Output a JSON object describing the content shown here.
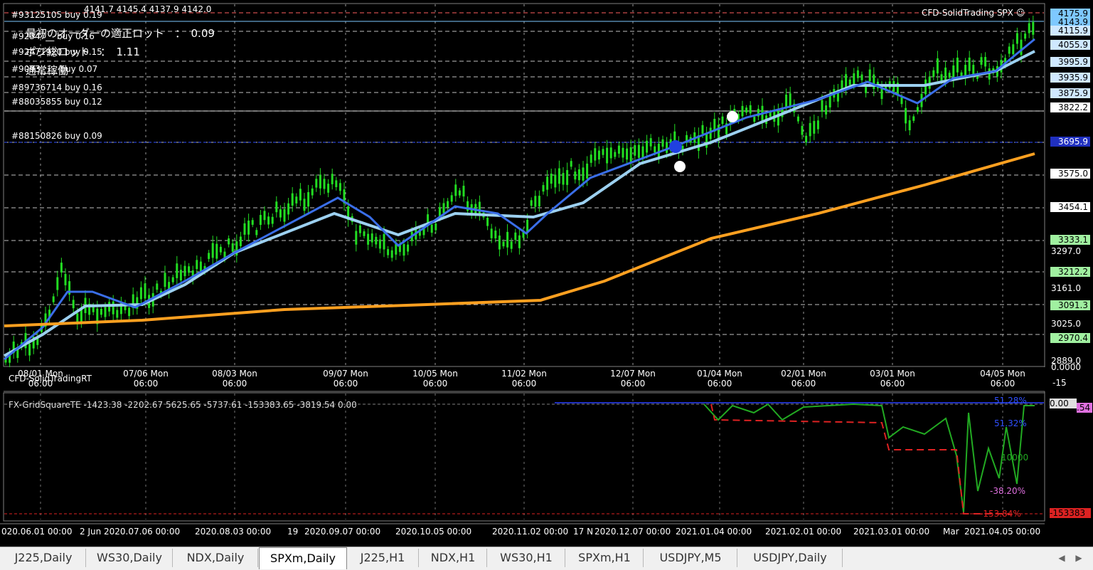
{
  "symbol_title": "CFD-SolidTrading SPX",
  "ohlc": "4141.7 4145.4 4137.9 4142.0",
  "info": {
    "first_order_lot": "最初のオーダーの適正ロット　：　0.09",
    "total_lot": "ポジ総ロット　：　1.11",
    "status": "通常稼働"
  },
  "orders": [
    "#93125105 buy 0.19",
    "#92347__ buy 0.16",
    "#92471920 buy 0.15",
    "#9093____ buy 0.07",
    "#89736714 buy 0.16",
    "#88035855 buy 0.12",
    "#88150826 buy 0.09"
  ],
  "price_axis": {
    "boxes": [
      {
        "value": "4175.9",
        "color": "#7ec8ff"
      },
      {
        "value": "4143.9",
        "color": "#7ec8ff"
      },
      {
        "value": "4115.9",
        "color": "#cfe8ff"
      },
      {
        "value": "4055.9",
        "color": "#cfe8ff"
      },
      {
        "value": "3995.9",
        "color": "#cfe8ff"
      },
      {
        "value": "3935.9",
        "color": "#cfe8ff"
      },
      {
        "value": "3875.9",
        "color": "#cfe8ff"
      },
      {
        "value": "3822.2",
        "color": "#ffffff"
      },
      {
        "value": "3695.9",
        "color": "#2030c0"
      },
      {
        "value": "3575.0",
        "color": "#ffffff"
      },
      {
        "value": "3454.1",
        "color": "#ffffff"
      },
      {
        "value": "3333.1",
        "color": "#a0f0a0"
      },
      {
        "value": "3212.2",
        "color": "#a0f0a0"
      },
      {
        "value": "3091.3",
        "color": "#a0f0a0"
      },
      {
        "value": "2970.4",
        "color": "#a0f0a0"
      }
    ],
    "ticks": [
      "3297.0",
      "3161.0",
      "3025.0",
      "2889.0"
    ]
  },
  "time_axis": [
    {
      "date": "08/01 Mon",
      "time": "06:00"
    },
    {
      "date": "07/06 Mon",
      "time": "06:00"
    },
    {
      "date": "08/03 Mon",
      "time": "06:00"
    },
    {
      "date": "09/07 Mon",
      "time": "06:00"
    },
    {
      "date": "10/05 Mon",
      "time": "06:00"
    },
    {
      "date": "11/02 Mon",
      "time": "06:00"
    },
    {
      "date": "12/07 Mon",
      "time": "06:00"
    },
    {
      "date": "01/04 Mon",
      "time": "06:00"
    },
    {
      "date": "02/01 Mon",
      "time": "06:00"
    },
    {
      "date": "03/01 Mon",
      "time": "06:00"
    },
    {
      "date": "04/05 Mon",
      "time": "06:00"
    }
  ],
  "sub_chart": {
    "indicator_top": "CFD-SolidTradingRT",
    "axis_top": "0.0000",
    "axis_bottom": "-15",
    "indicator2": "FX-GridSquareTE -1423.38 -2202.67 5625.65 -5737.61 -153383.65 -3819.54 0.00",
    "axis_zero": "0.00",
    "axis_side": ".54",
    "pct_top": "51.28%",
    "pct_2": "51.32%",
    "val_mid": "10000",
    "pct_3": "-38.20%",
    "pct_4": "-153.84%",
    "val_bottom": "-153383"
  },
  "bottom_axis": [
    "020.06.01 00:00",
    "2 Jun",
    "2020.07.06 00:00",
    "2020.08.03 00:00",
    "19",
    "2020.09.07 00:00",
    "2020.10.05 00:00",
    "2020.11.02 00:00",
    "17 N",
    "2020.12.07 00:00",
    "2021.01.04 00:00",
    "2021.02.01 00:00",
    "2021.03.01 00:00",
    "Mar",
    "2021.04.05 00:00"
  ],
  "tabs": [
    {
      "label": "J225,Daily",
      "active": false
    },
    {
      "label": "WS30,Daily",
      "active": false
    },
    {
      "label": "NDX,Daily",
      "active": false
    },
    {
      "label": "SPXm,Daily",
      "active": true
    },
    {
      "label": "J225,H1",
      "active": false
    },
    {
      "label": "NDX,H1",
      "active": false
    },
    {
      "label": "WS30,H1",
      "active": false
    },
    {
      "label": "SPXm,H1",
      "active": false
    },
    {
      "label": "USDJPY,M5",
      "active": false
    },
    {
      "label": "USDJPY,Daily",
      "active": false
    }
  ],
  "icons": {
    "prev": "chevron-left-icon",
    "next": "chevron-right-icon",
    "smiley": "smiley-icon"
  },
  "colors": {
    "candles": "#22dd22",
    "ma_fast": "#3a6ee8",
    "ma_slow": "#9cd0f0",
    "ma_long": "#ffa020",
    "equity": "#22aa22",
    "drawdown": "#dd2222",
    "balance": "#2030c0"
  }
}
